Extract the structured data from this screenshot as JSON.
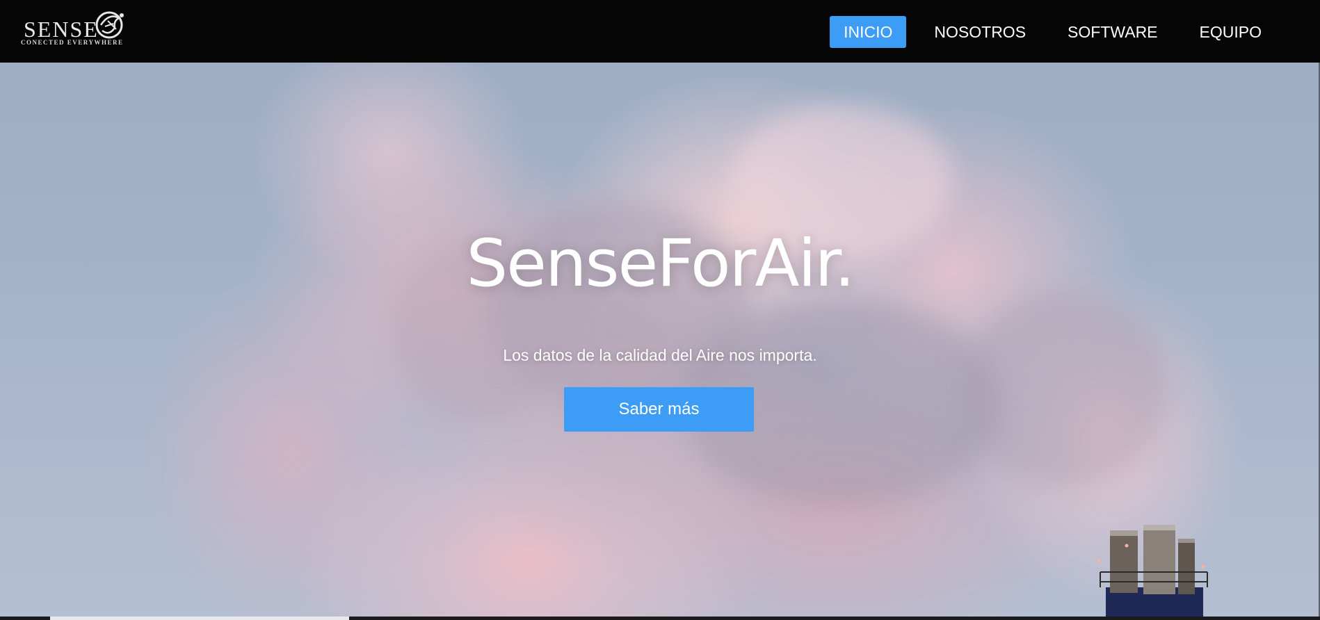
{
  "theme": {
    "accent": "#3d9cf5",
    "navbar_bg": "#050505"
  },
  "logo": {
    "name": "SENSE",
    "tagline": "CONECTED EVERYWHERE"
  },
  "nav": {
    "items": [
      {
        "label": "INICIO",
        "active": true
      },
      {
        "label": "NOSOTROS",
        "active": false
      },
      {
        "label": "SOFTWARE",
        "active": false
      },
      {
        "label": "EQUIPO",
        "active": false
      }
    ]
  },
  "hero": {
    "title": "SenseForAir.",
    "subtitle": "Los datos de la calidad del Aire nos importa.",
    "cta_label": "Saber más"
  }
}
